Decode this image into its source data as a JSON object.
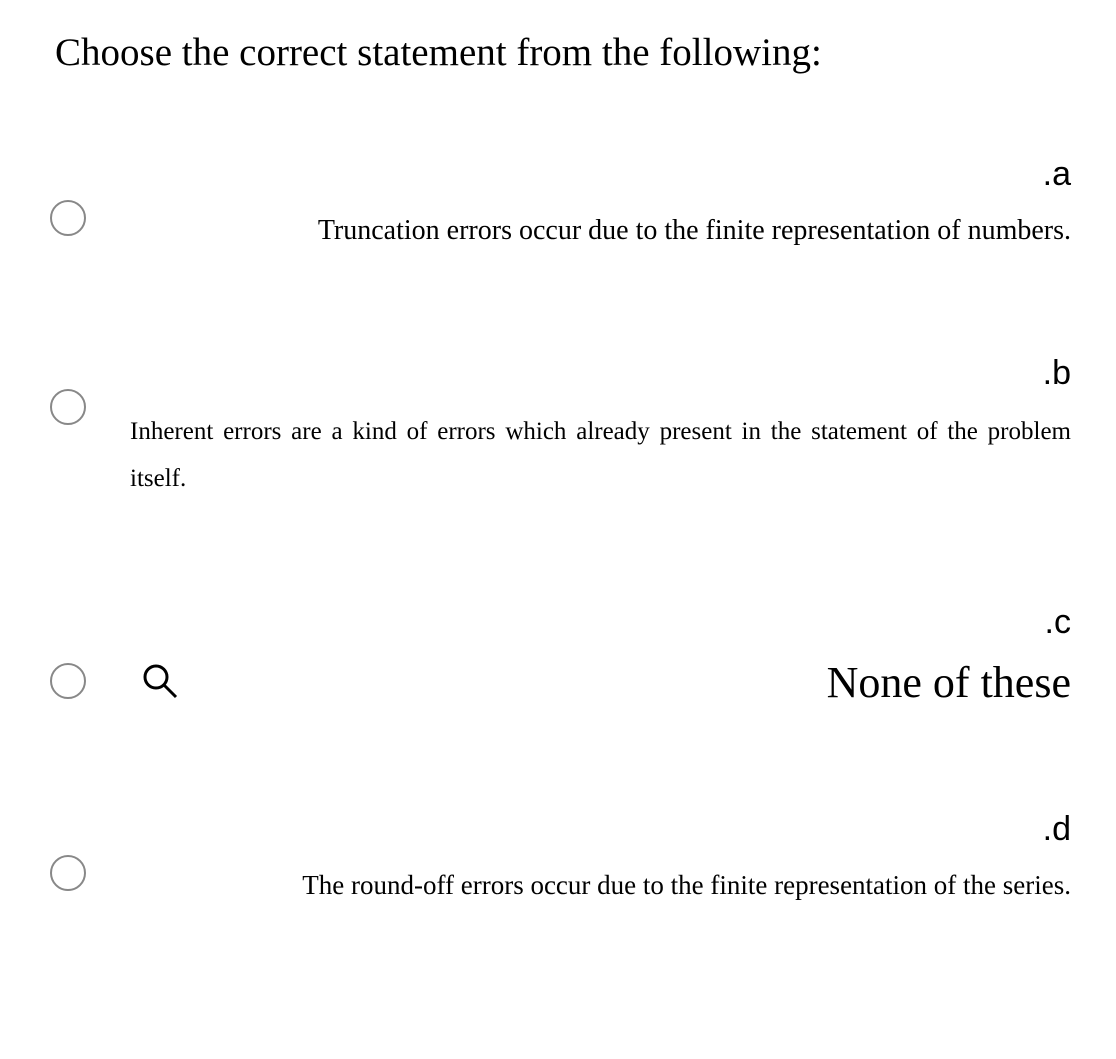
{
  "question": {
    "prompt": "Choose the correct statement from  the following:"
  },
  "options": [
    {
      "letter": ".a",
      "text": "Truncation errors occur due to the finite representation of numbers."
    },
    {
      "letter": ".b",
      "text": "Inherent errors are a kind of errors which already present in the statement of the problem itself."
    },
    {
      "letter": ".c",
      "text": "None of  these"
    },
    {
      "letter": ".d",
      "text": "The round-off errors occur due to the finite representation of the series."
    }
  ]
}
